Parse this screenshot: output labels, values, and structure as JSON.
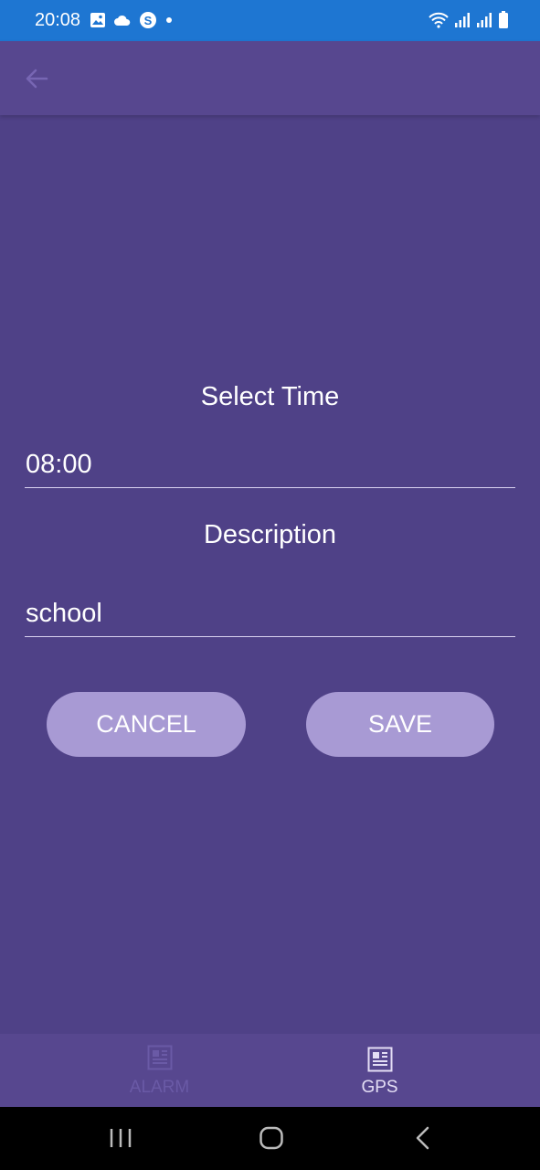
{
  "status_bar": {
    "time": "20:08",
    "left_icons": [
      "image-icon",
      "cloud-icon",
      "skype-icon",
      "notification-dot-icon"
    ],
    "right_icons": [
      "wifi-icon",
      "signal-icon",
      "signal-icon",
      "battery-icon"
    ]
  },
  "app_bar": {
    "back_icon": "arrow-left-icon"
  },
  "form": {
    "time_label": "Select Time",
    "time_value": "08:00",
    "description_label": "Description",
    "description_value": "school",
    "cancel_label": "CANCEL",
    "save_label": "SAVE"
  },
  "bottom_nav": {
    "items": [
      {
        "label": "ALARM",
        "icon": "list-icon",
        "active": false
      },
      {
        "label": "GPS",
        "icon": "list-icon",
        "active": true
      }
    ]
  },
  "system_nav": [
    "recents-icon",
    "home-icon",
    "back-icon"
  ],
  "colors": {
    "status_bar": "#1e76d2",
    "background": "#4f4187",
    "app_bar": "#57478f",
    "button": "#a89ad4",
    "inactive_nav": "#6a5aa6"
  }
}
